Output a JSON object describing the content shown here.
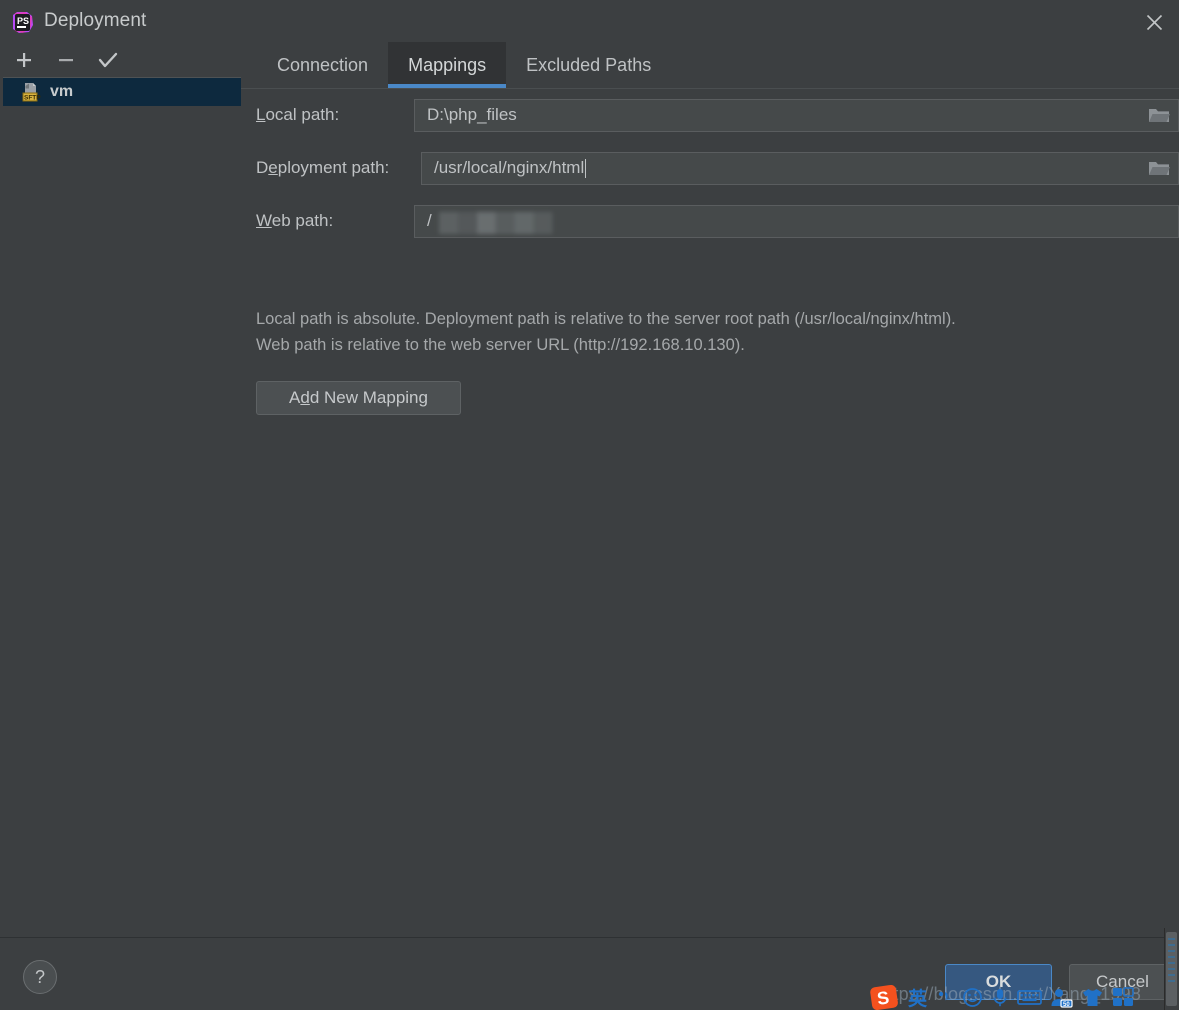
{
  "window": {
    "title": "Deployment",
    "app_icon": "phpstorm-logo-icon",
    "close_icon": "close-icon"
  },
  "left_pane": {
    "toolbar": [
      {
        "name": "add-server-button",
        "icon": "plus-icon",
        "label": "+"
      },
      {
        "name": "remove-server-button",
        "icon": "minus-icon",
        "label": "−"
      },
      {
        "name": "set-default-button",
        "icon": "check-icon",
        "label": "✓"
      }
    ],
    "servers": [
      {
        "label": "vm",
        "protocol": "SFTP",
        "icon": "sftp-server-icon",
        "selected": true
      }
    ]
  },
  "tabs": [
    {
      "label": "Connection",
      "active": false
    },
    {
      "label": "Mappings",
      "active": true
    },
    {
      "label": "Excluded Paths",
      "active": false
    }
  ],
  "mappings": {
    "local_path": {
      "label_pre": "L",
      "label_post": "ocal path:",
      "value": "D:\\php_files",
      "browse_icon": "folder-icon",
      "has_browse": true,
      "redacted": false
    },
    "deployment_path": {
      "label_pre": "D",
      "label_mid": "e",
      "label_post": "ployment path:",
      "value": "/usr/local/nginx/html",
      "browse_icon": "folder-icon",
      "has_browse": true,
      "redacted": false
    },
    "web_path": {
      "label_pre": "W",
      "label_post": "eb path:",
      "value": "/",
      "browse_icon": "",
      "has_browse": false,
      "redacted": true
    },
    "description_line_1": "Local path is absolute. Deployment path is relative to the server root path (/usr/local/nginx/html).",
    "description_line_2": "Web path is relative to the web server URL (http://192.168.10.130).",
    "add_mapping": {
      "pre": "A",
      "mnemonic": "d",
      "post": "d New Mapping"
    }
  },
  "footer": {
    "help_label": "?",
    "ok_label": "OK",
    "cancel_label": "Cancel"
  },
  "watermark": {
    "text": "https://blog.csdn.net/Yang_1998"
  },
  "ime": {
    "logo": "sogou-logo-icon",
    "items": [
      {
        "name": "ime-language-mode",
        "icon": "chinese-english-icon",
        "glyph": "英"
      },
      {
        "name": "ime-punctuation",
        "icon": "punctuation-icon",
        "glyph": "”,"
      },
      {
        "name": "ime-emoji",
        "icon": "emoji-icon",
        "glyph": "☺"
      },
      {
        "name": "ime-voice-input",
        "icon": "microphone-icon",
        "glyph": "•"
      },
      {
        "name": "ime-soft-keyboard",
        "icon": "keyboard-icon",
        "glyph": ""
      },
      {
        "name": "ime-user-center",
        "icon": "user-icon",
        "glyph": ""
      },
      {
        "name": "ime-skin",
        "icon": "tshirt-icon",
        "glyph": ""
      },
      {
        "name": "ime-toolbox",
        "icon": "toolbox-grid-icon",
        "glyph": ""
      }
    ]
  },
  "colors": {
    "dialog_bg": "#3c3f41",
    "field_bg": "#45494a",
    "selection_blue": "#0d293e",
    "accent_blue": "#4a88c7",
    "ok_button_bg": "#365880",
    "sftp_badge": "#c9a227",
    "ime_blue": "#2071c7"
  }
}
